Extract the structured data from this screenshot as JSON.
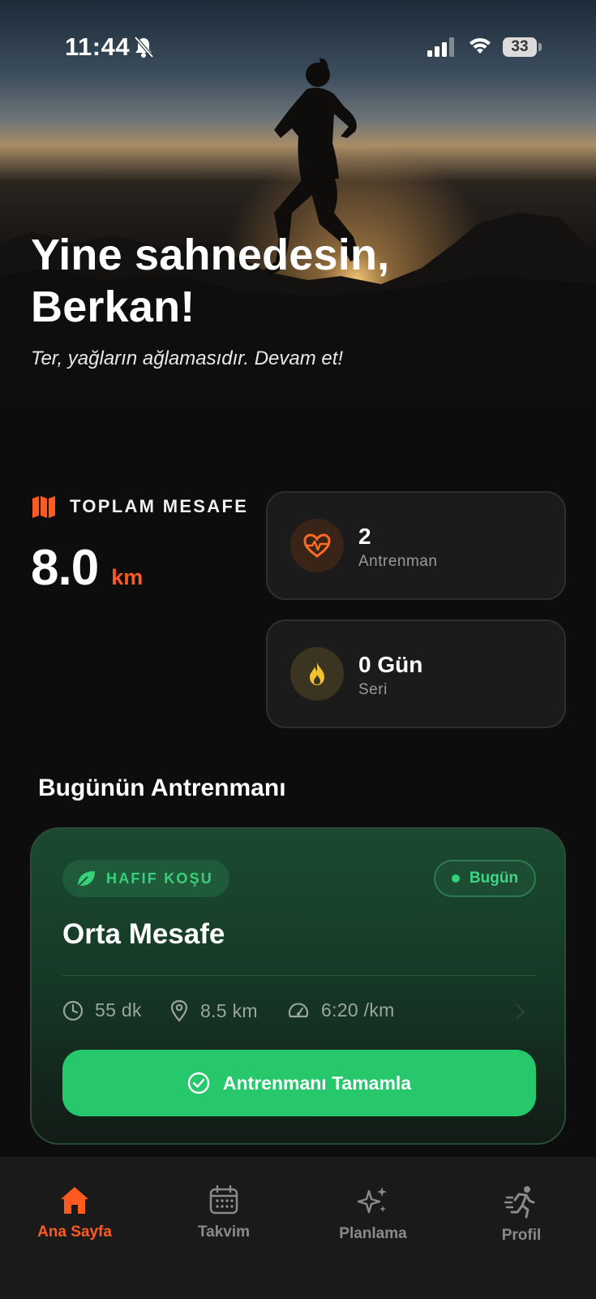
{
  "status_bar": {
    "time": "11:44",
    "battery": "33"
  },
  "hero": {
    "greeting": "Yine sahnedesin, Berkan!",
    "quote": "Ter, yağların ağlamasıdır. Devam et!"
  },
  "stats": {
    "distance_label": "TOPLAM MESAFE",
    "distance_value": "8.0",
    "distance_unit": "km",
    "workouts": {
      "value": "2",
      "label": "Antrenman"
    },
    "streak": {
      "value": "0 Gün",
      "label": "Seri"
    }
  },
  "today_section": {
    "title": "Bugünün Antrenmanı",
    "card": {
      "tag": "HAFIF KOŞU",
      "badge": "Bugün",
      "title": "Orta Mesafe",
      "duration": "55 dk",
      "distance": "8.5 km",
      "pace": "6:20 /km",
      "button": "Antrenmanı Tamamla"
    }
  },
  "tabbar": {
    "items": [
      {
        "label": "Ana Sayfa",
        "icon": "home-icon",
        "active": true
      },
      {
        "label": "Takvim",
        "icon": "calendar-icon",
        "active": false
      },
      {
        "label": "Planlama",
        "icon": "sparkles-icon",
        "active": false
      },
      {
        "label": "Profil",
        "icon": "runner-icon",
        "active": false
      }
    ]
  },
  "colors": {
    "accent": "#ff5a1f",
    "green": "#26c86b",
    "background": "#0d0d0d"
  }
}
